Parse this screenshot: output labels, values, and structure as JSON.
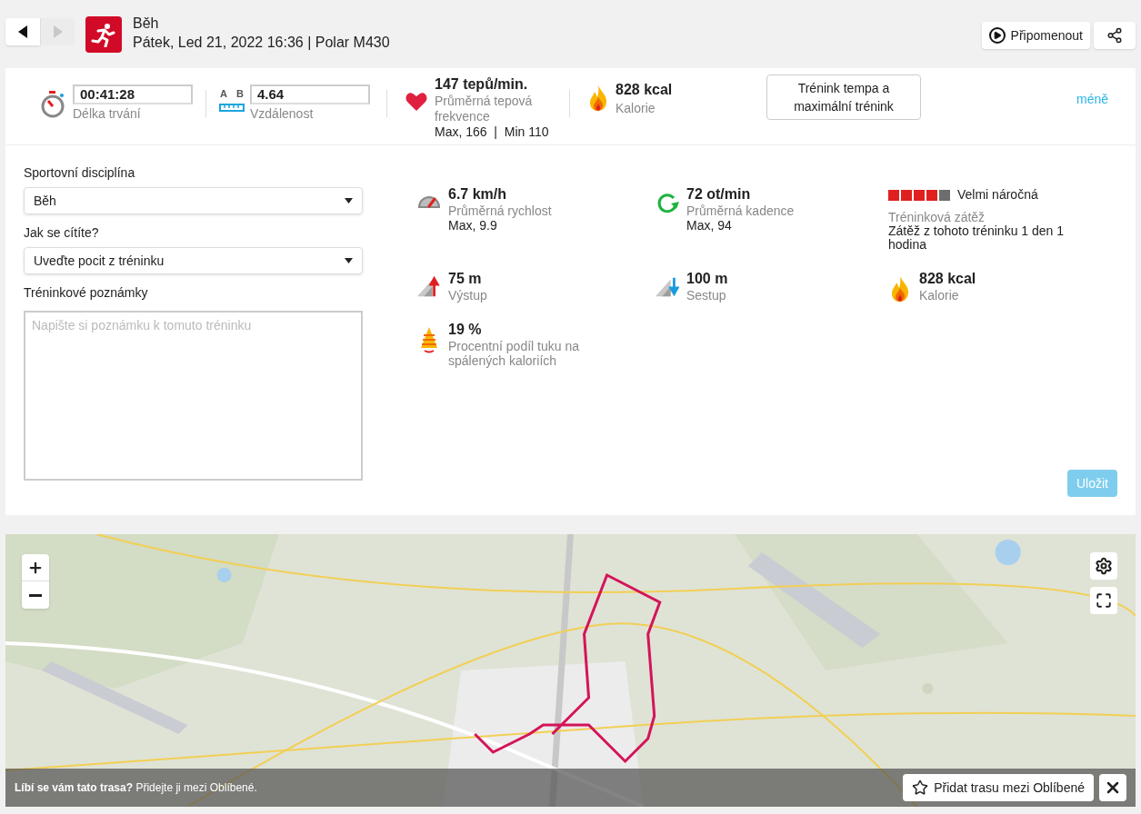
{
  "nav": {
    "prev_disabled": false,
    "next_disabled": true
  },
  "header": {
    "sport": "Běh",
    "subtitle": "Pátek, Led 21, 2022 16:36 | Polar M430"
  },
  "actions": {
    "replay": "Připomenout"
  },
  "summary": {
    "duration": {
      "value": "00:41:28",
      "label": "Délka trvání"
    },
    "distance": {
      "a": "A",
      "b": "B",
      "value": "4.64",
      "label": "Vzdálenost"
    },
    "heart": {
      "value": "147 tepů/min.",
      "label": "Průměrná tepová frekvence",
      "detail": "Max, 166  |  Min 110"
    },
    "calories": {
      "value": "828 kcal",
      "label": "Kalorie"
    },
    "benefit": "Trénink tempa a maximální trénink",
    "less_link": "méně"
  },
  "form": {
    "sport_label": "Sportovní disciplína",
    "sport_value": "Běh",
    "feeling_label": "Jak se cítíte?",
    "feeling_value": "Uveďte pocit z tréninku",
    "notes_label": "Tréninkové poznámky",
    "notes_placeholder": "Napište si poznámku k tomuto tréninku",
    "save": "Uložit"
  },
  "metrics": [
    {
      "kind": "speed",
      "value": "6.7 km/h",
      "label": "Průměrná rychlost",
      "detail": "Max, 9.9"
    },
    {
      "kind": "cadence",
      "value": "72 ot/min",
      "label": "Průměrná kadence",
      "detail": "Max, 94"
    },
    {
      "kind": "load",
      "stars": 4,
      "value": "Velmi náročná",
      "label": "Tréninková zátěž",
      "detail": "Zátěž z tohoto tréninku 1 den 1 hodina"
    },
    {
      "kind": "ascent",
      "value": "75 m",
      "label": "Výstup"
    },
    {
      "kind": "descent",
      "value": "100 m",
      "label": "Sestup"
    },
    {
      "kind": "calories",
      "value": "828 kcal",
      "label": "Kalorie"
    },
    {
      "kind": "fat",
      "value": "19 %",
      "label": "Procentní podíl tuku na spálených kaloriích"
    }
  ],
  "map": {
    "kind": "picture",
    "banner": "**Líbí se vám tato trasa?** Přidejte ji mezi Oblíbené.",
    "favorite": "Přidat trasu mezi Oblíbené"
  }
}
